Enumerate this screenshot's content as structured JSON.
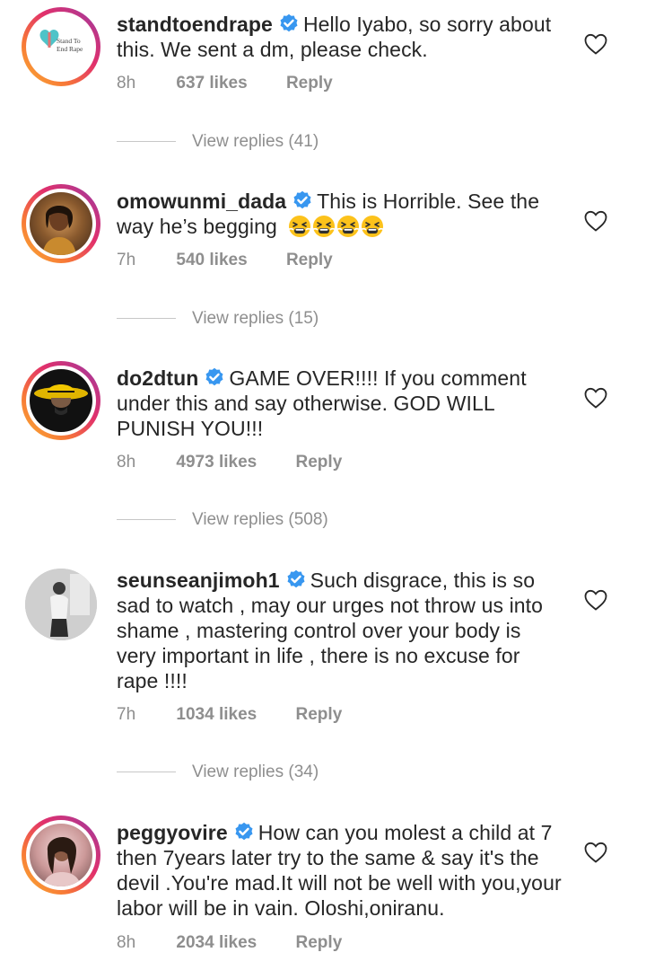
{
  "comments": [
    {
      "username": "standtoendrape",
      "avatar_text_line1": "Stand To",
      "avatar_text_line2": "End Rape",
      "text": "Hello Iyabo, so sorry about this. We sent a dm, please check.",
      "time": "8h",
      "likes": "637 likes",
      "reply": "Reply",
      "view_replies": "View replies (41)"
    },
    {
      "username": "omowunmi_dada",
      "text": "This is Horrible. See the way he’s begging",
      "emojis": [
        "tired-face-emoji",
        "tired-face-emoji",
        "tired-face-emoji",
        "tired-face-emoji"
      ],
      "time": "7h",
      "likes": "540 likes",
      "reply": "Reply",
      "view_replies": "View replies (15)"
    },
    {
      "username": "do2dtun",
      "text": "GAME OVER!!!! If you comment under this and say otherwise. GOD WILL PUNISH YOU!!!",
      "time": "8h",
      "likes": "4973 likes",
      "reply": "Reply",
      "view_replies": "View replies (508)"
    },
    {
      "username": "seunseanjimoh1",
      "text": "Such disgrace, this is so sad to watch , may our urges not throw us into shame , mastering control over your body is very important in life , there is no excuse for rape !!!!",
      "time": "7h",
      "likes": "1034 likes",
      "reply": "Reply",
      "view_replies": "View replies (34)"
    },
    {
      "username": "peggyovire",
      "text": "How can you molest a child at 7 then 7years later try to the same & say it's the devil .You're mad.It will not be well with you,your labor will be in vain. Oloshi,oniranu.",
      "time": "8h",
      "likes": "2034 likes",
      "reply": "Reply"
    }
  ],
  "colors": {
    "verified": "#3897f0",
    "meta": "#8e8e8e",
    "text": "#262626"
  },
  "icons": {
    "verified": "verified-badge-icon",
    "like": "heart-outline-icon"
  }
}
